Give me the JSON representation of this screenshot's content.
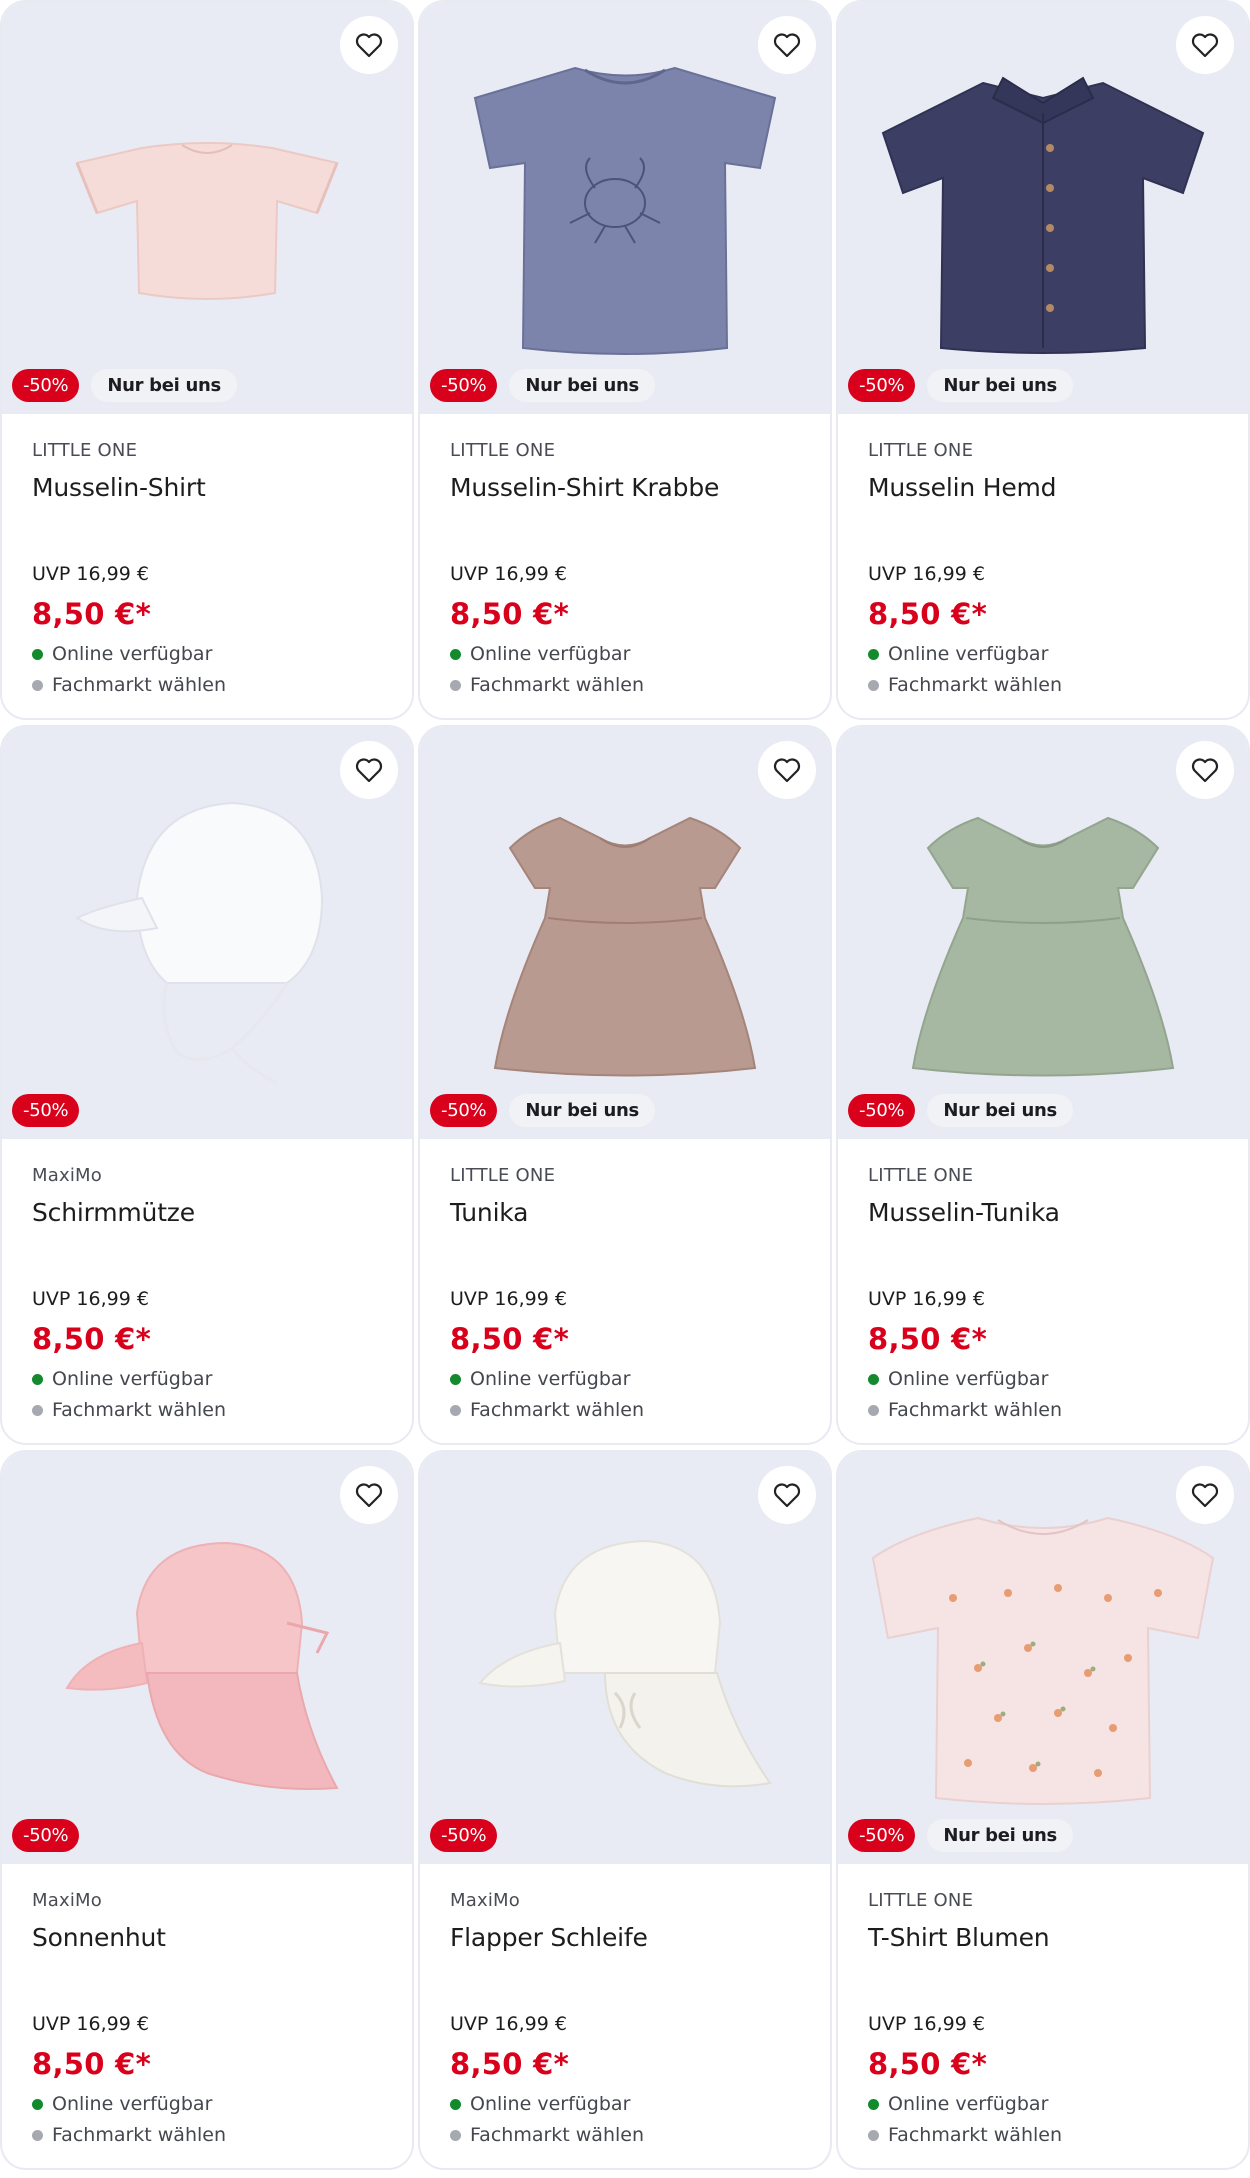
{
  "colors": {
    "accent_red": "#d8001b",
    "image_background": "#e8ebf4",
    "online_dot": "#148a2e",
    "store_dot": "#a7a9b0"
  },
  "products": [
    {
      "brand": "LITTLE ONE",
      "title": "Musselin-Shirt",
      "discount": "-50%",
      "exclusive": "Nur bei uns",
      "uvp": "UVP 16,99 €",
      "price": "8,50 €*",
      "online": "Online verfügbar",
      "store": "Fachmarkt wählen",
      "image": "pink-ruffle-shirt",
      "image_color": "#f6dcd8"
    },
    {
      "brand": "LITTLE ONE",
      "title": "Musselin-Shirt Krabbe",
      "discount": "-50%",
      "exclusive": "Nur bei uns",
      "uvp": "UVP 16,99 €",
      "price": "8,50 €*",
      "online": "Online verfügbar",
      "store": "Fachmarkt wählen",
      "image": "blue-crab-shirt",
      "image_color": "#7c84ab"
    },
    {
      "brand": "LITTLE ONE",
      "title": "Musselin Hemd",
      "discount": "-50%",
      "exclusive": "Nur bei uns",
      "uvp": "UVP 16,99 €",
      "price": "8,50 €*",
      "online": "Online verfügbar",
      "store": "Fachmarkt wählen",
      "image": "navy-button-shirt",
      "image_color": "#3c3f63"
    },
    {
      "brand": "MaxiMo",
      "title": "Schirmmütze",
      "discount": "-50%",
      "exclusive": "",
      "uvp": "UVP 16,99 €",
      "price": "8,50 €*",
      "online": "Online verfügbar",
      "store": "Fachmarkt wählen",
      "image": "white-cap",
      "image_color": "#f8f9fb"
    },
    {
      "brand": "LITTLE ONE",
      "title": "Tunika",
      "discount": "-50%",
      "exclusive": "Nur bei uns",
      "uvp": "UVP 16,99 €",
      "price": "8,50 €*",
      "online": "Online verfügbar",
      "store": "Fachmarkt wählen",
      "image": "mauve-tunic",
      "image_color": "#b99a90"
    },
    {
      "brand": "LITTLE ONE",
      "title": "Musselin-Tunika",
      "discount": "-50%",
      "exclusive": "Nur bei uns",
      "uvp": "UVP 16,99 €",
      "price": "8,50 €*",
      "online": "Online verfügbar",
      "store": "Fachmarkt wählen",
      "image": "green-tunic",
      "image_color": "#a6b7a2"
    },
    {
      "brand": "MaxiMo",
      "title": "Sonnenhut",
      "discount": "-50%",
      "exclusive": "",
      "uvp": "UVP 16,99 €",
      "price": "8,50 €*",
      "online": "Online verfügbar",
      "store": "Fachmarkt wählen",
      "image": "pink-sun-hat",
      "image_color": "#f6c5c8"
    },
    {
      "brand": "MaxiMo",
      "title": "Flapper Schleife",
      "discount": "-50%",
      "exclusive": "",
      "uvp": "UVP 16,99 €",
      "price": "8,50 €*",
      "online": "Online verfügbar",
      "store": "Fachmarkt wählen",
      "image": "white-flap-hat",
      "image_color": "#f5f4f0"
    },
    {
      "brand": "LITTLE ONE",
      "title": "T-Shirt Blumen",
      "discount": "-50%",
      "exclusive": "Nur bei uns",
      "uvp": "UVP 16,99 €",
      "price": "8,50 €*",
      "online": "Online verfügbar",
      "store": "Fachmarkt wählen",
      "image": "floral-shirt",
      "image_color": "#f6e3e3"
    }
  ]
}
